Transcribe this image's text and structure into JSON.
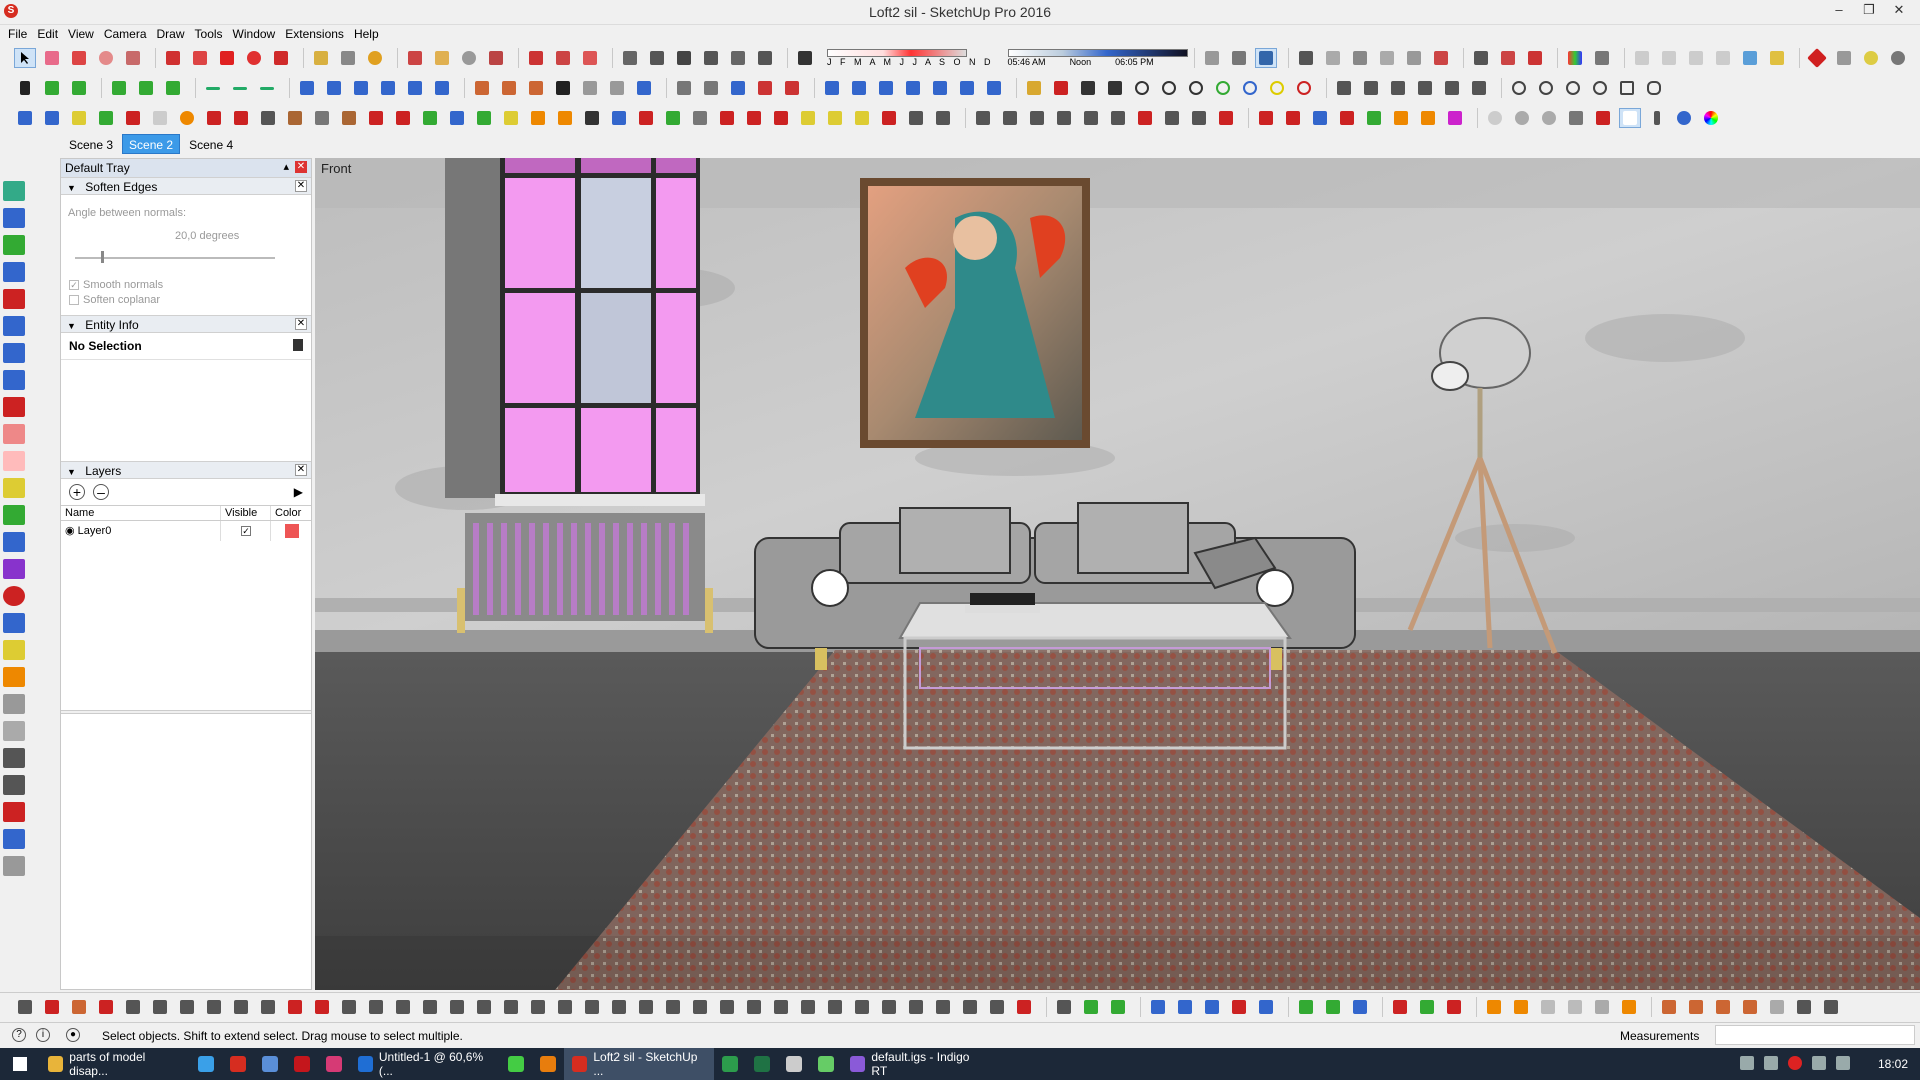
{
  "window": {
    "title": "Loft2 sil - SketchUp Pro 2016",
    "app_icon": "sketchup-logo-icon",
    "controls": [
      "minimize",
      "restore",
      "close"
    ]
  },
  "menu": [
    "File",
    "Edit",
    "View",
    "Camera",
    "Draw",
    "Tools",
    "Window",
    "Extensions",
    "Help"
  ],
  "shadow_settings": {
    "months": "J F M A M J J A S O N D",
    "time_start": "05:46 AM",
    "time_noon": "Noon",
    "time_end": "06:05 PM"
  },
  "scene_tabs": [
    {
      "label": "Scene 3",
      "active": false
    },
    {
      "label": "Scene 2",
      "active": true
    },
    {
      "label": "Scene 4",
      "active": false
    }
  ],
  "tray": {
    "title": "Default Tray",
    "soften_edges": {
      "title": "Soften Edges",
      "angle_label": "Angle between normals:",
      "angle_value": "20,0  degrees",
      "smooth_normals": "Smooth normals",
      "soften_coplanar": "Soften coplanar"
    },
    "entity_info": {
      "title": "Entity Info",
      "selection": "No Selection"
    },
    "layers": {
      "title": "Layers",
      "columns": [
        "Name",
        "Visible",
        "Color"
      ],
      "rows": [
        {
          "name": "Layer0",
          "visible": true,
          "color": "#ee5555"
        }
      ]
    }
  },
  "viewport": {
    "view_label": "Front"
  },
  "status": {
    "message": "Select objects. Shift to extend select. Drag mouse to select multiple.",
    "measurements_label": "Measurements"
  },
  "taskbar": {
    "items": [
      {
        "label": "parts of model disap...",
        "icon": "chrome-icon",
        "color": "#e8b43a",
        "wide": true
      },
      {
        "label": "",
        "icon": "ie-icon",
        "color": "#3aa0e8"
      },
      {
        "label": "",
        "icon": "sketchup-icon",
        "color": "#d62d20"
      },
      {
        "label": "",
        "icon": "outlook-icon",
        "color": "#5a8fd8"
      },
      {
        "label": "",
        "icon": "acrobat-icon",
        "color": "#c4161c"
      },
      {
        "label": "",
        "icon": "indesign-icon",
        "color": "#d63a75"
      },
      {
        "label": "Untitled-1 @ 60,6% (...",
        "icon": "photoshop-icon",
        "color": "#1f6ed4",
        "wide": true
      },
      {
        "label": "",
        "icon": "media-icon",
        "color": "#4c4"
      },
      {
        "label": "",
        "icon": "blender-icon",
        "color": "#e87d0d"
      },
      {
        "label": "Loft2 sil - SketchUp ...",
        "icon": "sketchup-icon",
        "color": "#d62d20",
        "wide": true,
        "active": true
      },
      {
        "label": "",
        "icon": "app-icon",
        "color": "#2c9c4c"
      },
      {
        "label": "",
        "icon": "excel-icon",
        "color": "#1f7244"
      },
      {
        "label": "",
        "icon": "app-icon",
        "color": "#ccc"
      },
      {
        "label": "",
        "icon": "sync-icon",
        "color": "#6c6"
      },
      {
        "label": "default.igs - Indigo RT",
        "icon": "indigo-icon",
        "color": "#8a5ad8",
        "wide": true
      }
    ],
    "clock": "18:02"
  }
}
